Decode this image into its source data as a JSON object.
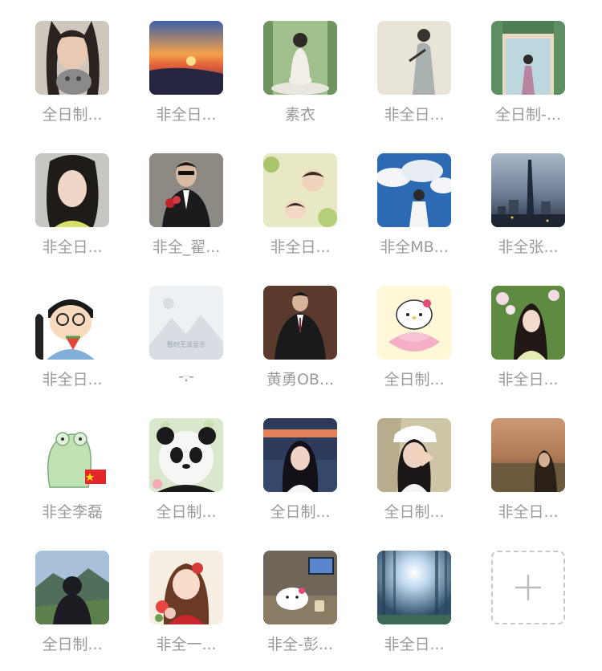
{
  "members": [
    {
      "name": "全日制...",
      "avatar": "portrait-woman-with-cat"
    },
    {
      "name": "非全日...",
      "avatar": "sunset-landscape"
    },
    {
      "name": "素衣",
      "avatar": "meditating-woman-forest"
    },
    {
      "name": "非全日...",
      "avatar": "illustrated-woman"
    },
    {
      "name": "全日制-...",
      "avatar": "woman-doorway-greenery"
    },
    {
      "name": "非全日...",
      "avatar": "portrait-woman"
    },
    {
      "name": "非全_翟...",
      "avatar": "man-in-suit-with-roses"
    },
    {
      "name": "非全日...",
      "avatar": "sleeping-babies"
    },
    {
      "name": "非全MB...",
      "avatar": "person-under-clouds"
    },
    {
      "name": "非全张...",
      "avatar": "city-skyline-night"
    },
    {
      "name": "非全日...",
      "avatar": "cartoon-boy-eating-watermelon"
    },
    {
      "name": "-.-",
      "avatar": "image-placeholder"
    },
    {
      "name": "黄勇OB...",
      "avatar": "man-in-dark-suit"
    },
    {
      "name": "全日制...",
      "avatar": "hello-kitty-on-lotus"
    },
    {
      "name": "非全日...",
      "avatar": "woman-among-flowers"
    },
    {
      "name": "非全李磊",
      "avatar": "green-frog-with-flag"
    },
    {
      "name": "全日制...",
      "avatar": "panda"
    },
    {
      "name": "全日制...",
      "avatar": "woman-by-river-night"
    },
    {
      "name": "全日制...",
      "avatar": "woman-covering-face"
    },
    {
      "name": "非全日...",
      "avatar": "woman-at-sunset-field"
    },
    {
      "name": "全日制...",
      "avatar": "person-mountains"
    },
    {
      "name": "非全一...",
      "avatar": "illustrated-girl-with-flowers"
    },
    {
      "name": "非全-彭...",
      "avatar": "kitty-plush-desk"
    },
    {
      "name": "非全日...",
      "avatar": "forest-sunlight"
    }
  ],
  "add_button": {
    "icon": "plus-icon"
  },
  "placeholder_text": "暂时无法显示",
  "colors": {
    "label": "#9a9a9a",
    "dashed_border": "#c8c8c8",
    "plus": "#bdbdbd",
    "background": "#ffffff"
  }
}
